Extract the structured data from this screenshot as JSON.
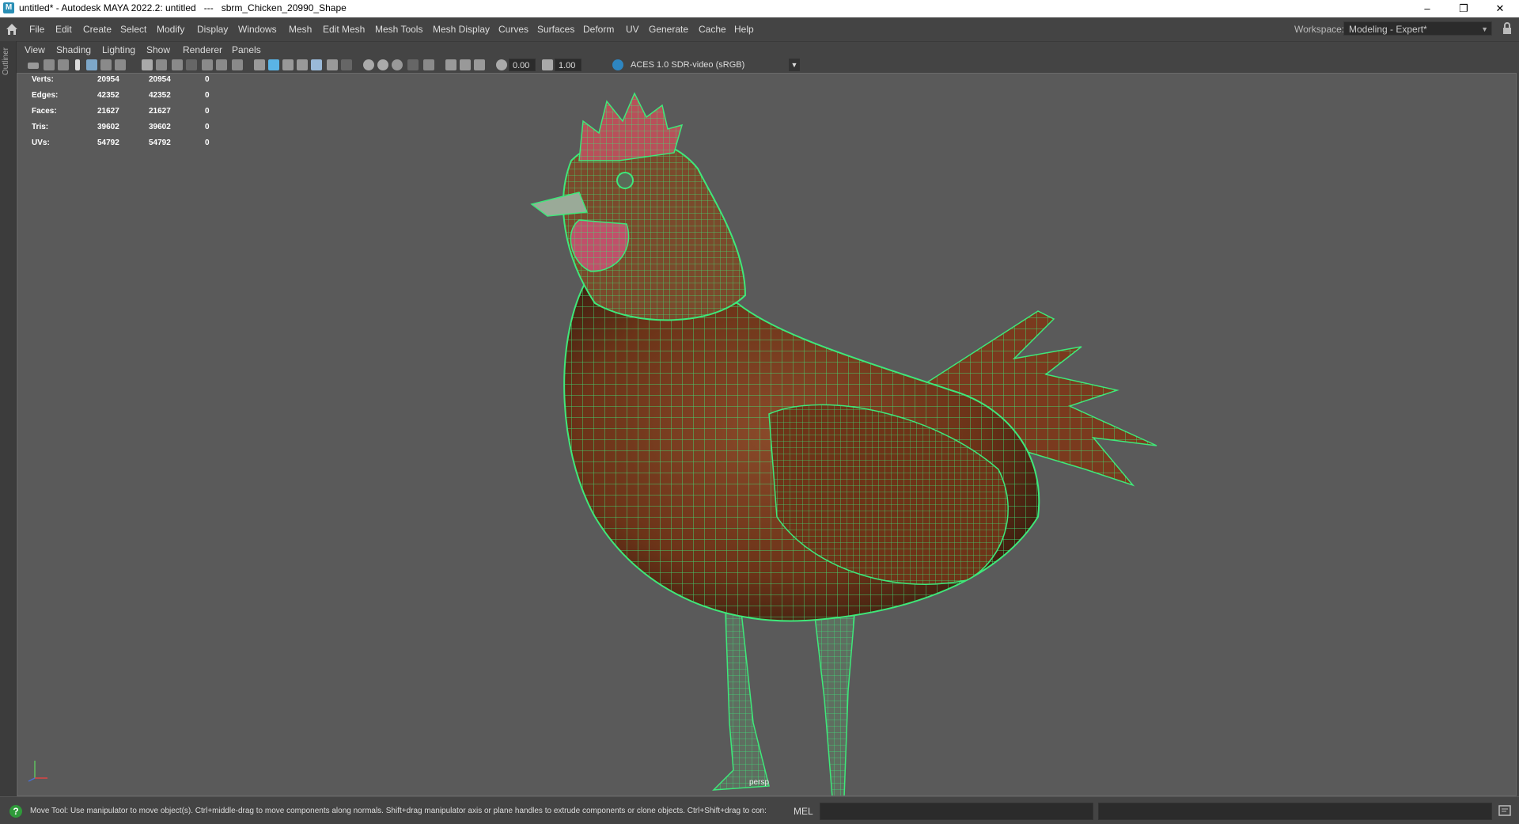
{
  "window": {
    "title": "untitled* - Autodesk MAYA 2022.2: untitled   ---   sbrm_Chicken_20990_Shape",
    "app_icon_letter": "M"
  },
  "menubar": {
    "items": [
      "File",
      "Edit",
      "Create",
      "Select",
      "Modify",
      "Display",
      "Windows",
      "Mesh",
      "Edit Mesh",
      "Mesh Tools",
      "Mesh Display",
      "Curves",
      "Surfaces",
      "Deform",
      "UV",
      "Generate",
      "Cache",
      "Help"
    ],
    "workspace_label": "Workspace:",
    "workspace_value": "Modeling - Expert*"
  },
  "outliner": {
    "label": "Outliner"
  },
  "panel_menu": {
    "items": [
      "View",
      "Shading",
      "Lighting",
      "Show",
      "Renderer",
      "Panels"
    ]
  },
  "toolbar": {
    "exposure": "0.00",
    "gamma": "1.00",
    "color_space": "ACES 1.0 SDR-video (sRGB)"
  },
  "hud": {
    "rows": [
      {
        "label": "Verts:",
        "a": "20954",
        "b": "20954",
        "c": "0"
      },
      {
        "label": "Edges:",
        "a": "42352",
        "b": "42352",
        "c": "0"
      },
      {
        "label": "Faces:",
        "a": "21627",
        "b": "21627",
        "c": "0"
      },
      {
        "label": "Tris:",
        "a": "39602",
        "b": "39602",
        "c": "0"
      },
      {
        "label": "UVs:",
        "a": "54792",
        "b": "54792",
        "c": "0"
      }
    ]
  },
  "viewport": {
    "camera": "persp",
    "wire_color": "#3ee87a",
    "background": "#5a5a5a"
  },
  "status": {
    "help_line": "Move Tool: Use manipulator to move object(s). Ctrl+middle-drag to move components along normals. Shift+drag manipulator axis or plane handles to extrude components or clone objects. Ctrl+Shift+drag to con:",
    "cmd_label": "MEL"
  }
}
